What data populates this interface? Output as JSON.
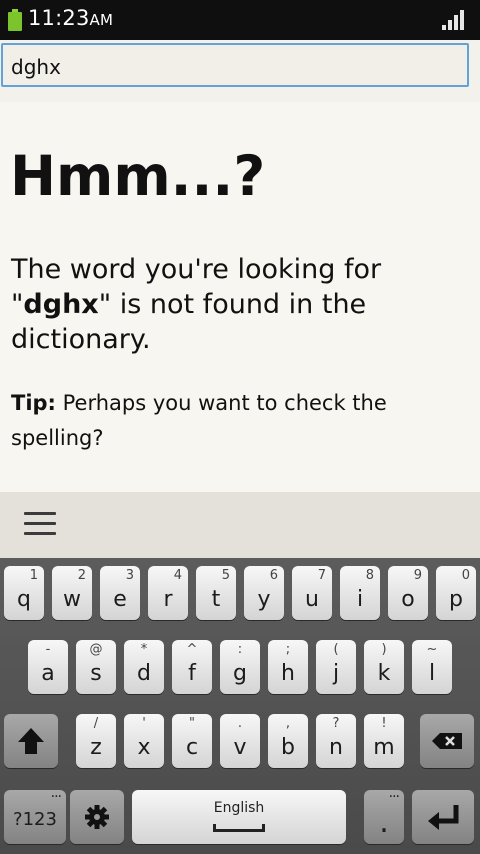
{
  "status": {
    "time": "11:23",
    "ampm": "AM"
  },
  "search": {
    "value": "dghx"
  },
  "content": {
    "headline": "Hmm...?",
    "message_prefix": "The word you're looking for",
    "message_query": "dghx",
    "message_suffix": "is not found in the dictionary.",
    "tip_label": "Tip:",
    "tip_text": "Perhaps you want to check the spelling?"
  },
  "keyboard": {
    "row1": [
      {
        "key": "q",
        "hint": "1"
      },
      {
        "key": "w",
        "hint": "2"
      },
      {
        "key": "e",
        "hint": "3"
      },
      {
        "key": "r",
        "hint": "4"
      },
      {
        "key": "t",
        "hint": "5"
      },
      {
        "key": "y",
        "hint": "6"
      },
      {
        "key": "u",
        "hint": "7"
      },
      {
        "key": "i",
        "hint": "8"
      },
      {
        "key": "o",
        "hint": "9"
      },
      {
        "key": "p",
        "hint": "0"
      }
    ],
    "row2": [
      {
        "key": "a",
        "hint": "-"
      },
      {
        "key": "s",
        "hint": "@"
      },
      {
        "key": "d",
        "hint": "*"
      },
      {
        "key": "f",
        "hint": "^"
      },
      {
        "key": "g",
        "hint": ":"
      },
      {
        "key": "h",
        "hint": ";"
      },
      {
        "key": "j",
        "hint": "("
      },
      {
        "key": "k",
        "hint": ")"
      },
      {
        "key": "l",
        "hint": "~"
      }
    ],
    "row3": [
      {
        "key": "z",
        "hint": "/"
      },
      {
        "key": "x",
        "hint": "'"
      },
      {
        "key": "c",
        "hint": "\""
      },
      {
        "key": "v",
        "hint": "."
      },
      {
        "key": "b",
        "hint": ","
      },
      {
        "key": "n",
        "hint": "?"
      },
      {
        "key": "m",
        "hint": "!"
      }
    ],
    "symbols_label": "?123",
    "space_label": "English",
    "period_label": ".",
    "more_dots": "···"
  },
  "colors": {
    "accent": "#62a2d8",
    "battery": "#7cc42b"
  }
}
